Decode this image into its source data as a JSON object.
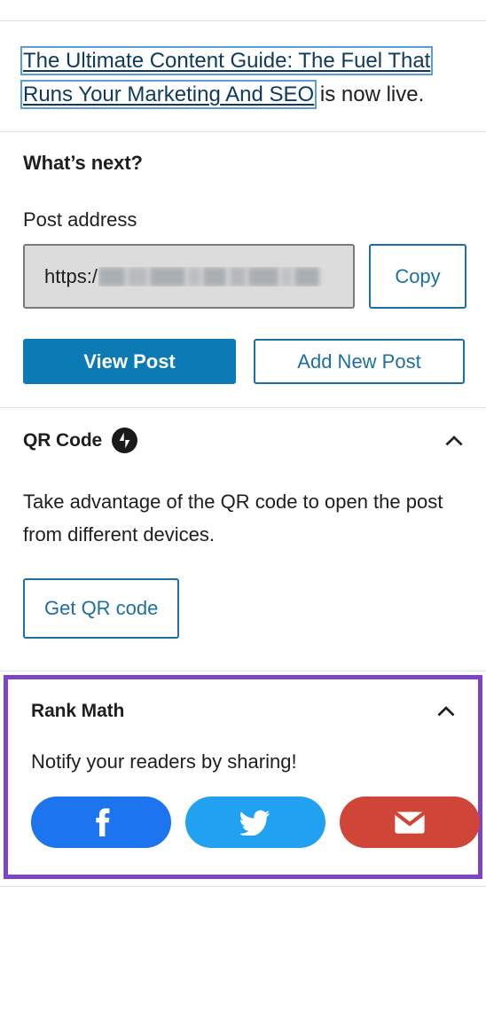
{
  "notice": {
    "link_text": "The Ultimate Content Guide: The Fuel That Runs Your Marketing And SEO",
    "suffix_text": " is now live."
  },
  "whats_next": {
    "heading": "What’s next?",
    "address_label": "Post address",
    "address_value_visible": "https:/",
    "address_value_redacted": true,
    "copy_label": "Copy",
    "view_post_label": "View Post",
    "add_new_post_label": "Add New Post"
  },
  "qr_panel": {
    "title": "QR Code",
    "badge_icon": "jetpack-icon",
    "toggle_icon": "chevron-up-icon",
    "description": "Take advantage of the QR code to open the post from different devices.",
    "button_label": "Get QR code"
  },
  "rank_math_panel": {
    "title": "Rank Math",
    "toggle_icon": "chevron-up-icon",
    "description": "Notify your readers by sharing!",
    "highlight_color": "#7e44c6",
    "share_buttons": [
      {
        "name": "facebook",
        "icon": "facebook-icon",
        "color": "#1d74ef"
      },
      {
        "name": "twitter",
        "icon": "twitter-icon",
        "color": "#21a1f1"
      },
      {
        "name": "email",
        "icon": "email-icon",
        "color": "#cf4537"
      }
    ]
  },
  "colors": {
    "primary_blue": "#0b7ab5",
    "link_blue": "#1d6fa3",
    "focus_outline": "#5b9dd9",
    "divider": "#e0e0e0"
  }
}
